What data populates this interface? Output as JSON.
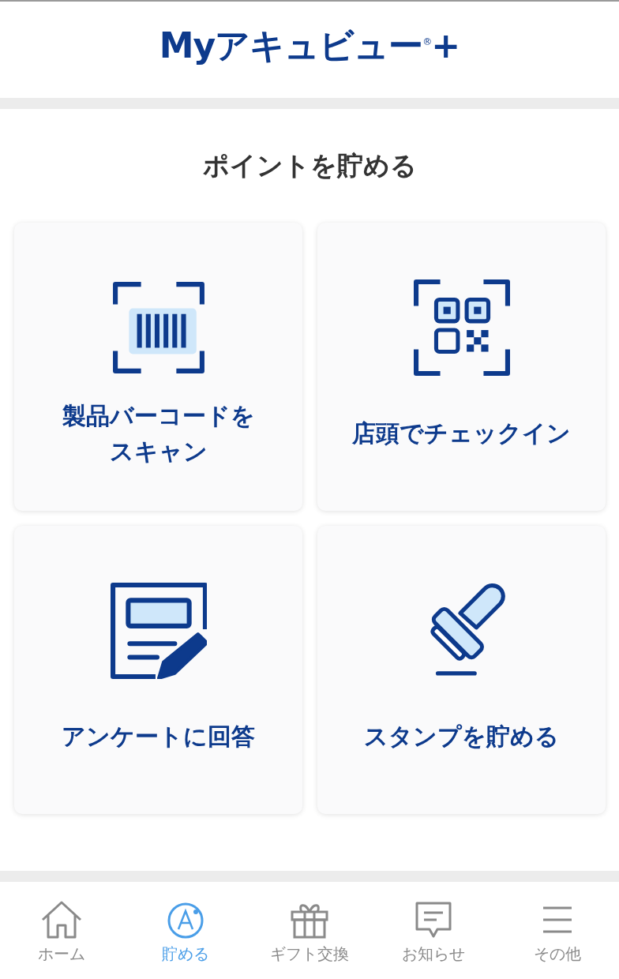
{
  "header": {
    "logo": "Myアキュビュー$^{®}$+"
  },
  "section": {
    "title": "ポイントを貯める"
  },
  "cards": [
    {
      "kind": "barcode",
      "label_lines": [
        "製品バーコードを",
        "スキャン"
      ]
    },
    {
      "kind": "qr",
      "label_lines": [
        "店頭でチェックイン"
      ]
    },
    {
      "kind": "survey",
      "label_lines": [
        "アンケートに回答"
      ]
    },
    {
      "kind": "stamp",
      "label_lines": [
        "スタンプを貯める"
      ]
    }
  ],
  "tab_bar": [
    {
      "kind": "home",
      "label": "ホーム",
      "selected": false
    },
    {
      "kind": "points",
      "label": "貯める",
      "selected": true
    },
    {
      "kind": "gift",
      "label": "ギフト交換",
      "selected": false
    },
    {
      "kind": "message",
      "label": "お知らせ",
      "selected": false
    },
    {
      "kind": "menu",
      "label": "その他",
      "selected": false
    }
  ]
}
